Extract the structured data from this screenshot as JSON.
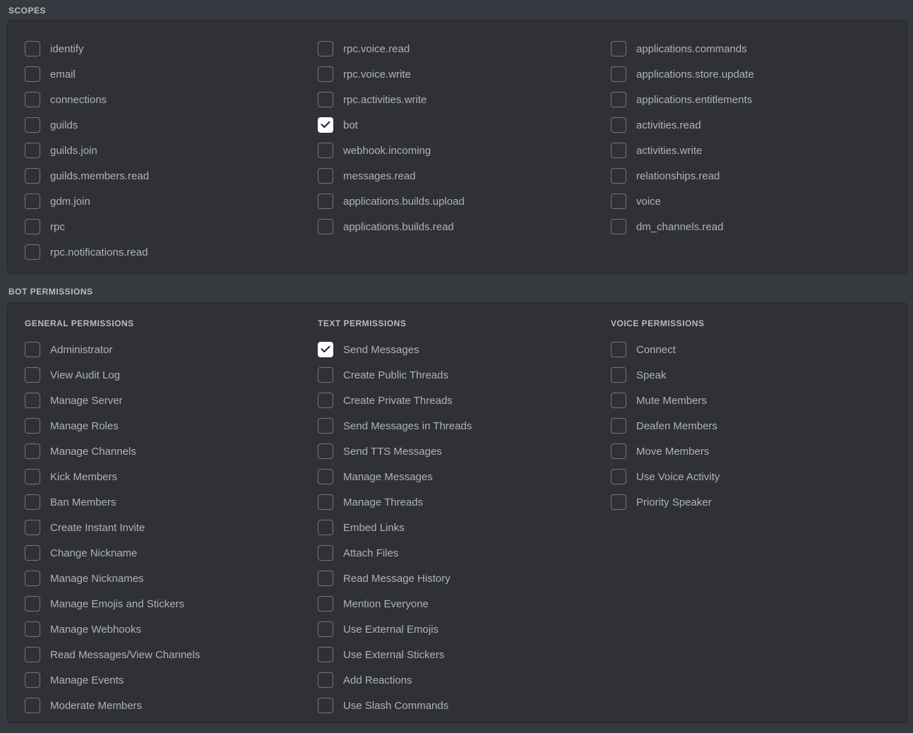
{
  "sections": {
    "scopes": {
      "label": "SCOPES",
      "columns": [
        {
          "items": [
            {
              "label": "identify",
              "checked": false
            },
            {
              "label": "email",
              "checked": false
            },
            {
              "label": "connections",
              "checked": false
            },
            {
              "label": "guilds",
              "checked": false
            },
            {
              "label": "guilds.join",
              "checked": false
            },
            {
              "label": "guilds.members.read",
              "checked": false
            },
            {
              "label": "gdm.join",
              "checked": false
            },
            {
              "label": "rpc",
              "checked": false
            },
            {
              "label": "rpc.notifications.read",
              "checked": false
            }
          ]
        },
        {
          "items": [
            {
              "label": "rpc.voice.read",
              "checked": false
            },
            {
              "label": "rpc.voice.write",
              "checked": false
            },
            {
              "label": "rpc.activities.write",
              "checked": false
            },
            {
              "label": "bot",
              "checked": true
            },
            {
              "label": "webhook.incoming",
              "checked": false
            },
            {
              "label": "messages.read",
              "checked": false
            },
            {
              "label": "applications.builds.upload",
              "checked": false
            },
            {
              "label": "applications.builds.read",
              "checked": false
            }
          ]
        },
        {
          "items": [
            {
              "label": "applications.commands",
              "checked": false
            },
            {
              "label": "applications.store.update",
              "checked": false
            },
            {
              "label": "applications.entitlements",
              "checked": false
            },
            {
              "label": "activities.read",
              "checked": false
            },
            {
              "label": "activities.write",
              "checked": false
            },
            {
              "label": "relationships.read",
              "checked": false
            },
            {
              "label": "voice",
              "checked": false
            },
            {
              "label": "dm_channels.read",
              "checked": false
            }
          ]
        }
      ]
    },
    "bot_permissions": {
      "label": "BOT PERMISSIONS",
      "columns": [
        {
          "header": "GENERAL PERMISSIONS",
          "items": [
            {
              "label": "Administrator",
              "checked": false
            },
            {
              "label": "View Audit Log",
              "checked": false
            },
            {
              "label": "Manage Server",
              "checked": false
            },
            {
              "label": "Manage Roles",
              "checked": false
            },
            {
              "label": "Manage Channels",
              "checked": false
            },
            {
              "label": "Kick Members",
              "checked": false
            },
            {
              "label": "Ban Members",
              "checked": false
            },
            {
              "label": "Create Instant Invite",
              "checked": false
            },
            {
              "label": "Change Nickname",
              "checked": false
            },
            {
              "label": "Manage Nicknames",
              "checked": false
            },
            {
              "label": "Manage Emojis and Stickers",
              "checked": false
            },
            {
              "label": "Manage Webhooks",
              "checked": false
            },
            {
              "label": "Read Messages/View Channels",
              "checked": false
            },
            {
              "label": "Manage Events",
              "checked": false
            },
            {
              "label": "Moderate Members",
              "checked": false
            }
          ]
        },
        {
          "header": "TEXT PERMISSIONS",
          "items": [
            {
              "label": "Send Messages",
              "checked": true
            },
            {
              "label": "Create Public Threads",
              "checked": false
            },
            {
              "label": "Create Private Threads",
              "checked": false
            },
            {
              "label": "Send Messages in Threads",
              "checked": false
            },
            {
              "label": "Send TTS Messages",
              "checked": false
            },
            {
              "label": "Manage Messages",
              "checked": false
            },
            {
              "label": "Manage Threads",
              "checked": false
            },
            {
              "label": "Embed Links",
              "checked": false
            },
            {
              "label": "Attach Files",
              "checked": false
            },
            {
              "label": "Read Message History",
              "checked": false
            },
            {
              "label": "Mention Everyone",
              "checked": false
            },
            {
              "label": "Use External Emojis",
              "checked": false
            },
            {
              "label": "Use External Stickers",
              "checked": false
            },
            {
              "label": "Add Reactions",
              "checked": false
            },
            {
              "label": "Use Slash Commands",
              "checked": false
            }
          ]
        },
        {
          "header": "VOICE PERMISSIONS",
          "items": [
            {
              "label": "Connect",
              "checked": false
            },
            {
              "label": "Speak",
              "checked": false
            },
            {
              "label": "Mute Members",
              "checked": false
            },
            {
              "label": "Deafen Members",
              "checked": false
            },
            {
              "label": "Move Members",
              "checked": false
            },
            {
              "label": "Use Voice Activity",
              "checked": false
            },
            {
              "label": "Priority Speaker",
              "checked": false
            }
          ]
        }
      ]
    }
  },
  "icons": {
    "checkmark": "check-icon"
  },
  "colors": {
    "page_background": "#36393f",
    "card_background": "#2f3136",
    "label_text": "#aeb2ba",
    "header_text": "#b9bbbe",
    "checkbox_border": "#72767d",
    "checkbox_checked_background": "#ffffff",
    "checkmark": "#1e1f22"
  }
}
